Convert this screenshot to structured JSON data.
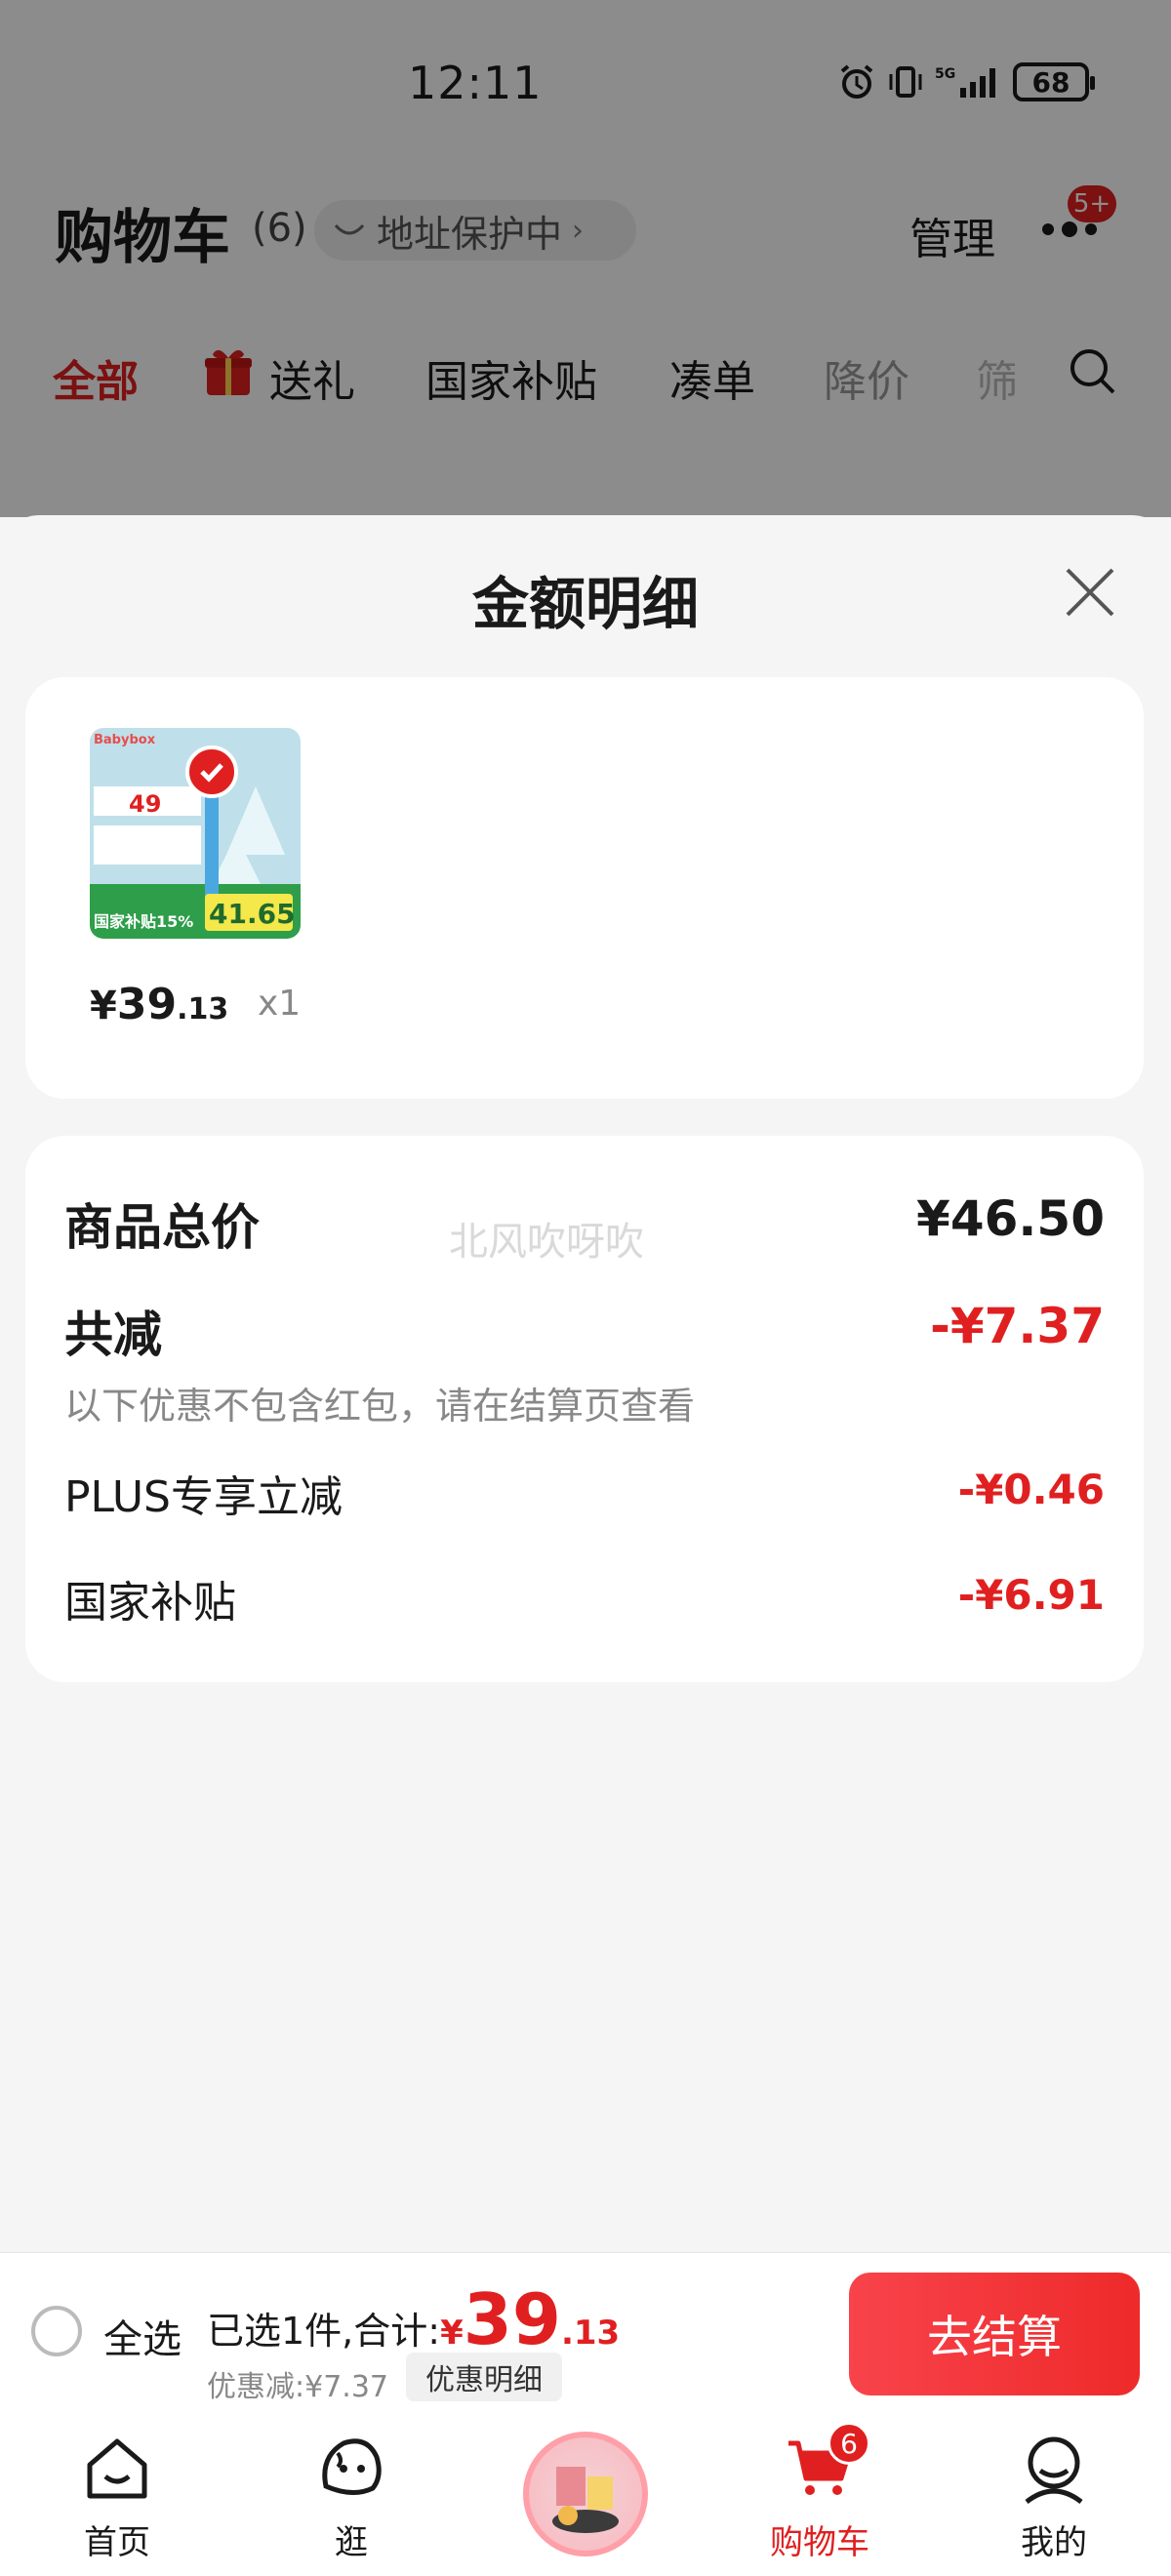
{
  "status_bar": {
    "time": "12:11",
    "battery": "68"
  },
  "header": {
    "title": "购物车",
    "count": "(6)",
    "address_protect": "地址保护中",
    "manage": "管理",
    "more_badge": "5+"
  },
  "filter_tabs": [
    "全部",
    "送礼",
    "国家补贴",
    "凑单",
    "降价",
    "筛"
  ],
  "sheet": {
    "title": "金额明细",
    "product": {
      "yen": "¥",
      "price_int": "39",
      "price_dec": ".13",
      "qty": "x1",
      "image_text": {
        "brand": "Babybox",
        "price": "49",
        "subsidy": "国家补贴15%",
        "final": "41.65"
      }
    },
    "details": {
      "total_label": "商品总价",
      "total_value": "¥46.50",
      "reduce_label": "共减",
      "reduce_value": "-¥7.37",
      "reduce_note": "以下优惠不包含红包，请在结算页查看",
      "rows": [
        {
          "label": "PLUS专享立减",
          "value": "-¥0.46"
        },
        {
          "label": "国家补贴",
          "value": "-¥6.91"
        }
      ]
    },
    "watermark": "北风吹呀吹"
  },
  "checkout": {
    "select_all": "全选",
    "summary_label": "已选1件,合计:",
    "yen": "¥",
    "total_int": "39",
    "total_dec": ".13",
    "discount": "优惠减:¥7.37",
    "detail_button": "优惠明细",
    "go_button": "去结算"
  },
  "tabbar": {
    "items": [
      {
        "label": "首页",
        "icon": "home-icon"
      },
      {
        "label": "逛",
        "icon": "browse-icon"
      },
      {
        "label": "",
        "icon": "center-promo-icon"
      },
      {
        "label": "购物车",
        "icon": "cart-icon",
        "badge": "6"
      },
      {
        "label": "我的",
        "icon": "profile-icon"
      }
    ]
  },
  "colors": {
    "accent": "#e02020",
    "sheet_bg": "#f5f5f5"
  }
}
